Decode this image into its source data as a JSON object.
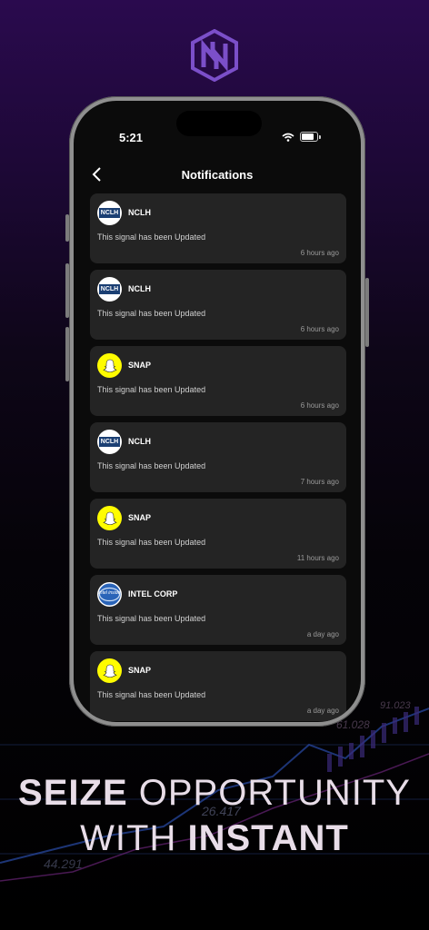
{
  "status_bar": {
    "time": "5:21"
  },
  "header": {
    "title": "Notifications"
  },
  "notifications": [
    {
      "ticker": "NCLH",
      "logo": "nclh-logo",
      "message": "This signal has been Updated",
      "time_ago": "6 hours ago"
    },
    {
      "ticker": "NCLH",
      "logo": "nclh-logo",
      "message": "This signal has been Updated",
      "time_ago": "6 hours ago"
    },
    {
      "ticker": "SNAP",
      "logo": "snapchat-ghost-logo",
      "message": "This signal has been Updated",
      "time_ago": "6 hours ago"
    },
    {
      "ticker": "NCLH",
      "logo": "nclh-logo",
      "message": "This signal has been Updated",
      "time_ago": "7 hours ago"
    },
    {
      "ticker": "SNAP",
      "logo": "snapchat-ghost-logo",
      "message": "This signal has been Updated",
      "time_ago": "11 hours ago"
    },
    {
      "ticker": "INTEL CORP",
      "logo": "intel-logo",
      "message": "This signal has been Updated",
      "time_ago": "a day ago"
    },
    {
      "ticker": "SNAP",
      "logo": "snapchat-ghost-logo",
      "message": "This signal has been Updated",
      "time_ago": "a day ago"
    }
  ],
  "nclh_logo_text": "NCLH",
  "intel_logo_text": "intel inside",
  "background_numbers": [
    "26.417",
    "44.291",
    "61.028",
    "91.023"
  ],
  "tagline": {
    "line1_bold": "SEIZE",
    "line1_rest": " OPPORTUNITY",
    "line2_rest": "WITH ",
    "line2_bold": "INSTANT"
  },
  "colors": {
    "accent": "#7b4fc9",
    "snap_yellow": "#fffc00",
    "card_bg": "#242424"
  }
}
